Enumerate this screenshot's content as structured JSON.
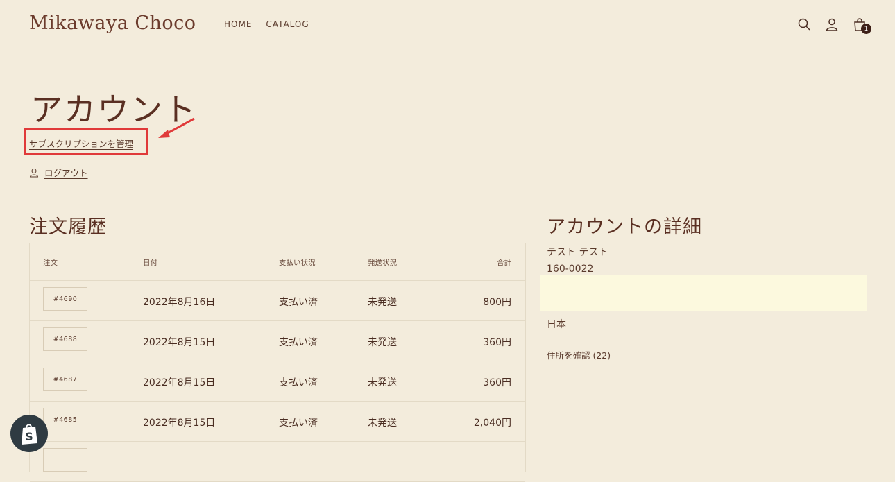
{
  "header": {
    "logo": "Mikawaya Choco",
    "nav": [
      "HOME",
      "CATALOG"
    ],
    "cart_count": "1",
    "icons": [
      "search-icon",
      "account-icon",
      "cart-icon"
    ]
  },
  "account": {
    "title": "アカウント",
    "manage_subscriptions": "サブスクリプションを管理",
    "logout": "ログアウト"
  },
  "orders": {
    "title": "注文履歴",
    "columns": [
      "注文",
      "日付",
      "支払い状況",
      "発送状況",
      "合計"
    ],
    "rows": [
      {
        "id": "#4690",
        "date": "2022年8月16日",
        "payment": "支払い済",
        "fulfillment": "未発送",
        "total": "800円"
      },
      {
        "id": "#4688",
        "date": "2022年8月15日",
        "payment": "支払い済",
        "fulfillment": "未発送",
        "total": "360円"
      },
      {
        "id": "#4687",
        "date": "2022年8月15日",
        "payment": "支払い済",
        "fulfillment": "未発送",
        "total": "360円"
      },
      {
        "id": "#4685",
        "date": "2022年8月15日",
        "payment": "支払い済",
        "fulfillment": "未発送",
        "total": "2,040円"
      }
    ]
  },
  "details": {
    "title": "アカウントの詳細",
    "name": "テスト テスト",
    "postal": "160-0022",
    "country": "日本",
    "view_addresses": "住所を確認 (22)"
  },
  "colors": {
    "background": "#f3ecdc",
    "text": "#5a3a2c",
    "annotation": "#e03a3a",
    "address_highlight": "#fcf9de"
  }
}
